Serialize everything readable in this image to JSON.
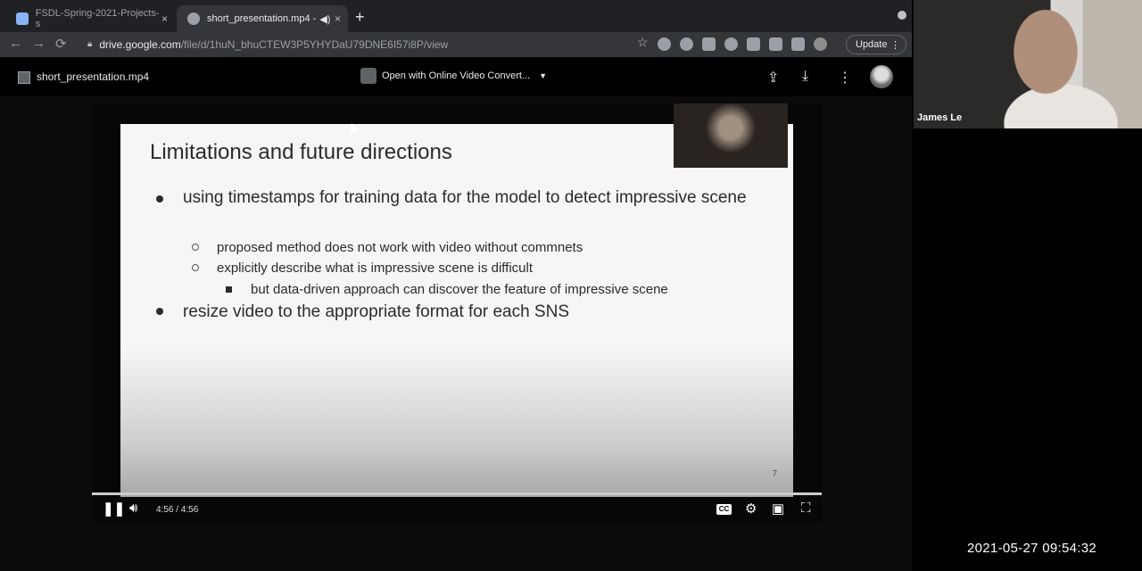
{
  "browser": {
    "tabs": [
      {
        "label": "FSDL-Spring-2021-Projects-s",
        "close": "×",
        "active": false
      },
      {
        "label": "short_presentation.mp4 -",
        "close": "×",
        "active": true
      }
    ],
    "new_tab": "+",
    "url_host": "drive.google.com",
    "url_path": "/file/d/1huN_bhuCTEW3P5YHYDaU79DNE6I57i8P/view",
    "update_label": "Update",
    "nav": {
      "back": "←",
      "forward": "→",
      "reload": "⟳"
    },
    "menu_dots": "⋮"
  },
  "viewer": {
    "file_name": "short_presentation.mp4",
    "open_with_label": "Open with Online Video Convert...",
    "caret": "▼",
    "icons": [
      "add-to-drive-icon",
      "download-icon",
      "more-icon"
    ]
  },
  "slide": {
    "title": "Limitations and future directions",
    "bullets": [
      "using timestamps for training data for the model to detect impressive scene",
      "resize video to the appropriate format for each SNS"
    ],
    "sub_bullets": [
      "proposed method does not work with video without commnets",
      "explicitly describe what is impressive scene is difficult"
    ],
    "sub_sub_bullet": "but data-driven approach can discover the feature of impressive scene",
    "page_number": "7"
  },
  "player": {
    "time": "4:56 / 4:56",
    "cc_label": "CC",
    "progress": 1.0
  },
  "webcam": {
    "name": "James Le"
  },
  "timestamp": "2021-05-27 09:54:32",
  "colors": {
    "chrome_bg": "#202124",
    "toolbar": "#35363a",
    "slide_bg": "#f6f6f6"
  }
}
